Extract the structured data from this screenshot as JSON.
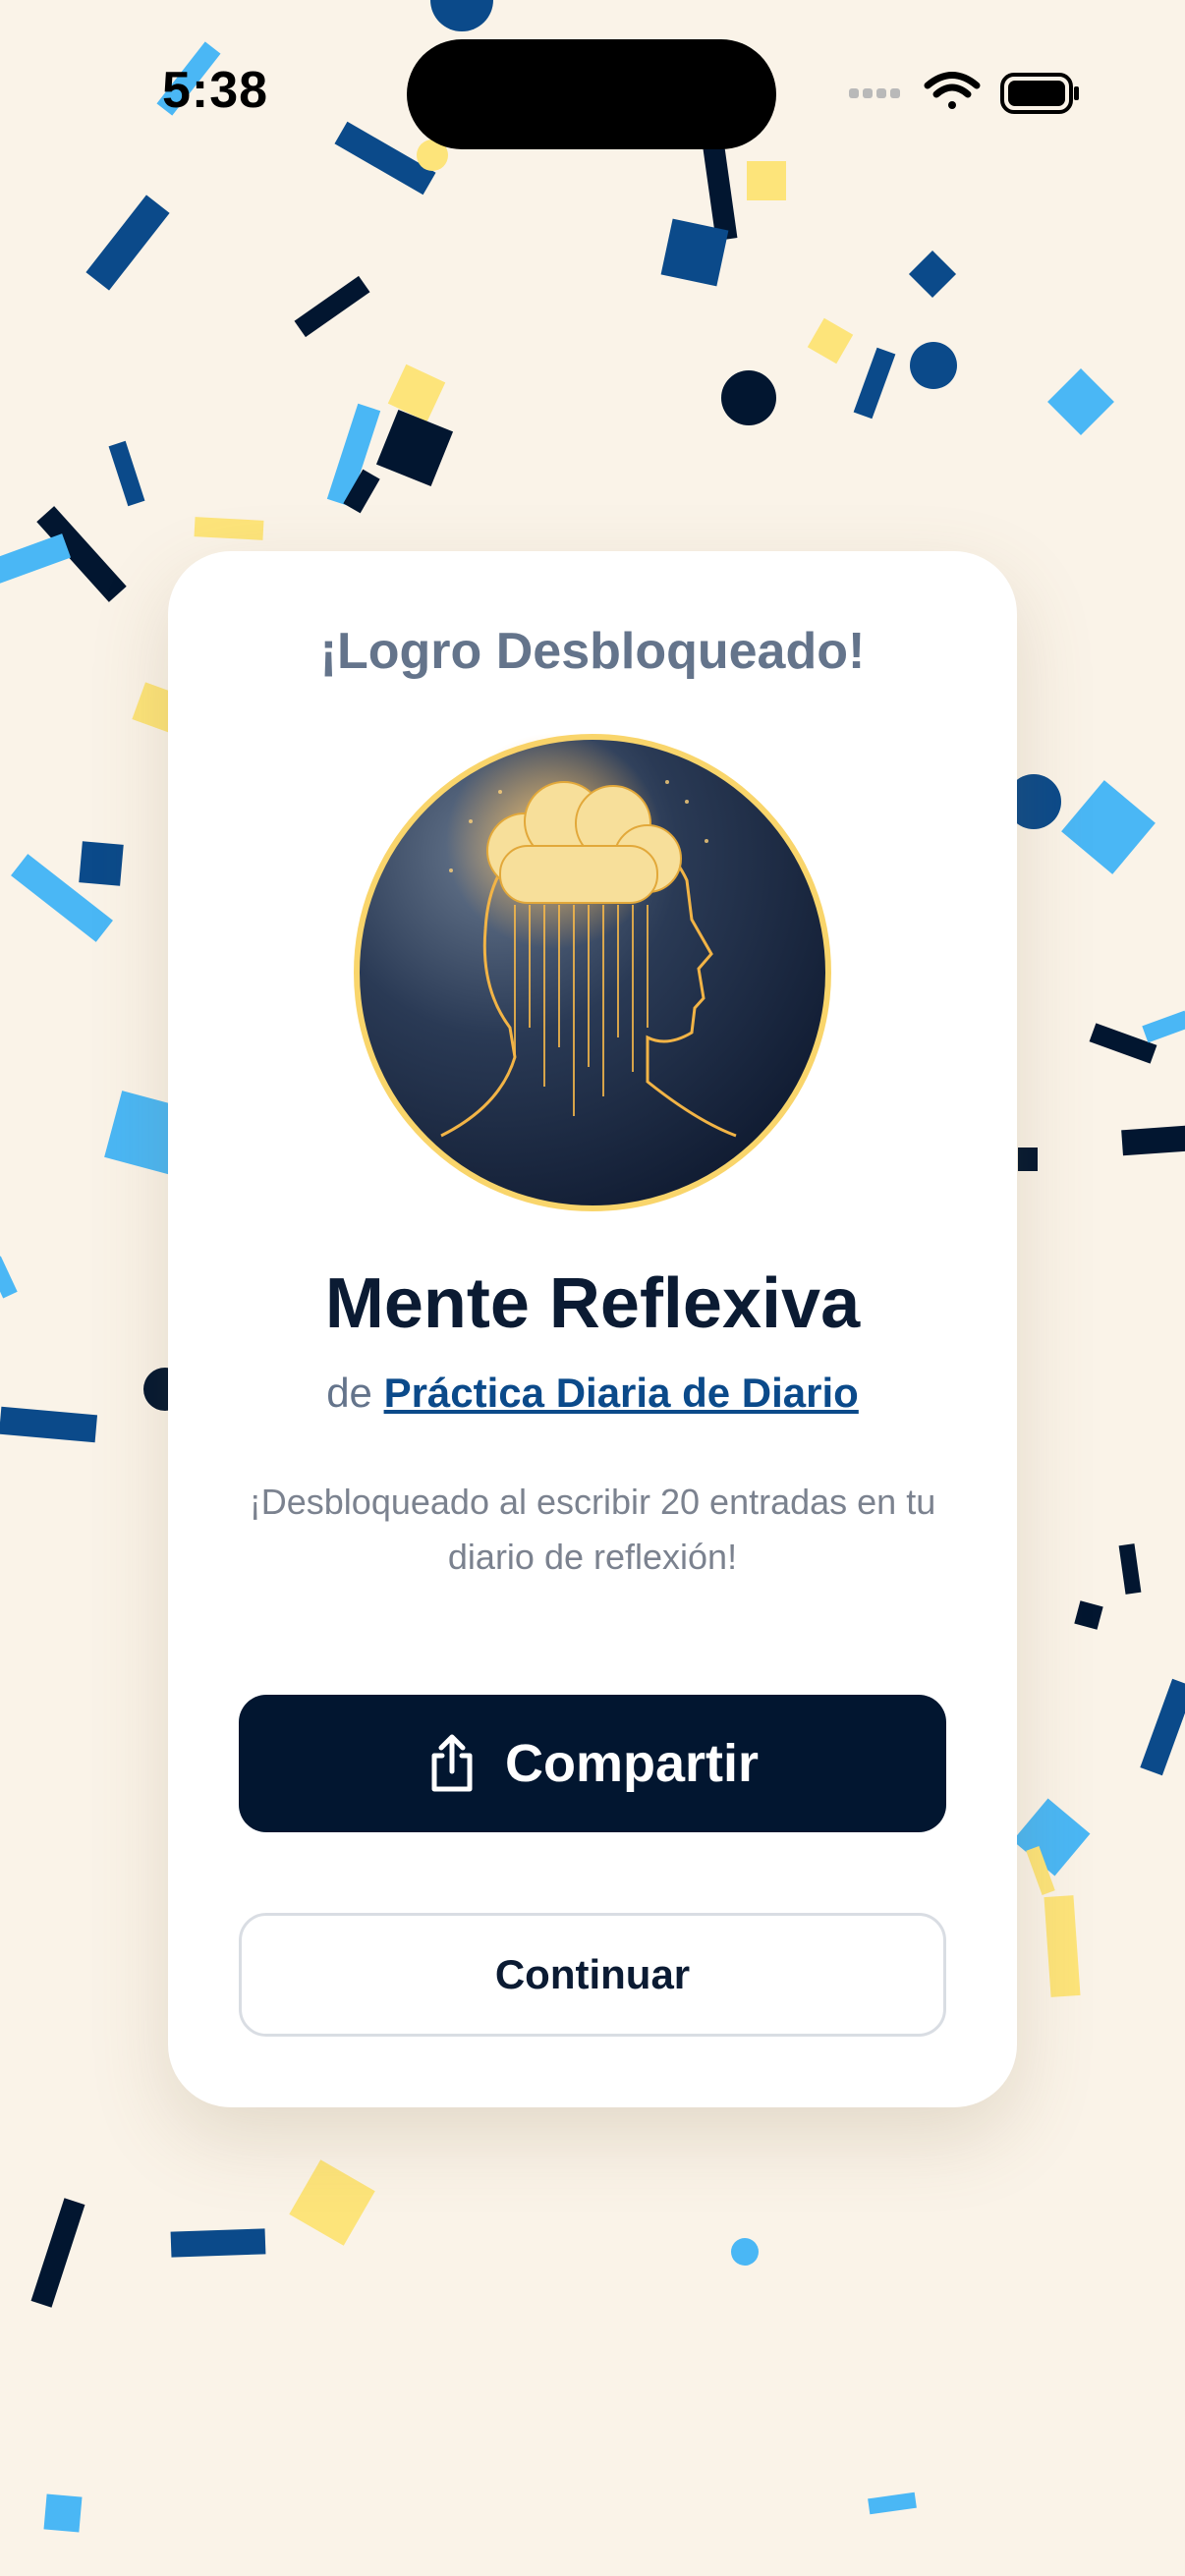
{
  "status_bar": {
    "time": "5:38"
  },
  "colors": {
    "background": "#faf3e8",
    "navy": "#0b4a8a",
    "dark_navy": "#021630",
    "sky_blue": "#4ab7f5",
    "yellow": "#fde47a",
    "badge_ring": "#f9d56b"
  },
  "card": {
    "heading": "¡Logro Desbloqueado!",
    "badge_icon": "glowing-head-thought-cloud",
    "achievement_name": "Mente Reflexiva",
    "source_prefix": "de",
    "source_link": "Práctica Diaria de Diario",
    "description": "¡Desbloqueado al escribir 20 entradas en tu diario de reflexión!",
    "share_label": "Compartir",
    "share_icon": "share-icon",
    "continue_label": "Continuar"
  }
}
